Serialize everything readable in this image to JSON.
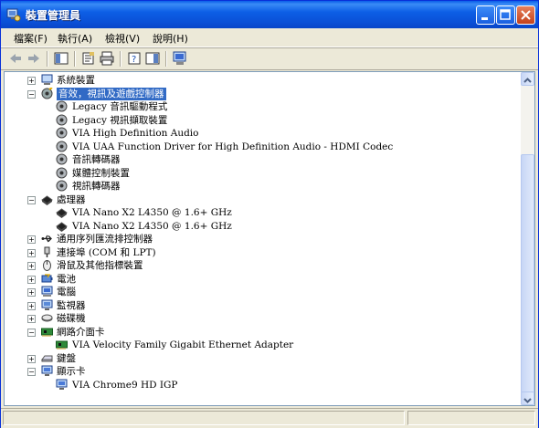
{
  "window": {
    "title": "裝置管理員"
  },
  "menu": [
    {
      "label": "檔案(F)"
    },
    {
      "label": "執行(A)"
    },
    {
      "label": "檢視(V)"
    },
    {
      "label": "說明(H)"
    }
  ],
  "tree": [
    {
      "label": "系統裝置",
      "icon": "system-device-icon",
      "expander": "+"
    },
    {
      "label": "音效，視訊及遊戲控制器",
      "icon": "sound-icon",
      "expander": "-",
      "selected": true
    },
    {
      "label": "Legacy 音訊驅動程式",
      "icon": "speaker-icon"
    },
    {
      "label": "Legacy 視訊擷取裝置",
      "icon": "speaker-icon"
    },
    {
      "label": "VIA High Definition Audio",
      "icon": "speaker-icon"
    },
    {
      "label": "VIA UAA Function Driver for High Definition Audio - HDMI Codec",
      "icon": "speaker-icon"
    },
    {
      "label": "音訊轉碼器",
      "icon": "speaker-icon"
    },
    {
      "label": "媒體控制裝置",
      "icon": "speaker-icon"
    },
    {
      "label": "視訊轉碼器",
      "icon": "speaker-icon"
    },
    {
      "label": "處理器",
      "icon": "cpu-icon",
      "expander": "-"
    },
    {
      "label": "VIA Nano X2 L4350 @ 1.6+ GHz",
      "icon": "cpu-icon"
    },
    {
      "label": "VIA Nano X2 L4350 @ 1.6+ GHz",
      "icon": "cpu-icon"
    },
    {
      "label": "通用序列匯流排控制器",
      "icon": "usb-icon",
      "expander": "+"
    },
    {
      "label": "連接埠 (COM 和 LPT)",
      "icon": "port-icon",
      "expander": "+"
    },
    {
      "label": "滑鼠及其他指標裝置",
      "icon": "mouse-icon",
      "expander": "+"
    },
    {
      "label": "電池",
      "icon": "battery-icon",
      "expander": "+"
    },
    {
      "label": "電腦",
      "icon": "computer-icon",
      "expander": "+"
    },
    {
      "label": "監視器",
      "icon": "monitor-icon",
      "expander": "+"
    },
    {
      "label": "磁碟機",
      "icon": "disk-drive-icon",
      "expander": "+"
    },
    {
      "label": "網路介面卡",
      "icon": "network-card-icon",
      "expander": "-"
    },
    {
      "label": "VIA Velocity Family Gigabit Ethernet Adapter",
      "icon": "network-card-icon"
    },
    {
      "label": "鍵盤",
      "icon": "keyboard-icon",
      "expander": "+"
    },
    {
      "label": "顯示卡",
      "icon": "display-adapter-icon",
      "expander": "-"
    },
    {
      "label": "VIA Chrome9 HD IGP",
      "icon": "display-adapter-icon"
    }
  ],
  "colors": {
    "titlebar": "#0a5de8",
    "selection": "#316ac5",
    "window_bg": "#ece9d8"
  }
}
